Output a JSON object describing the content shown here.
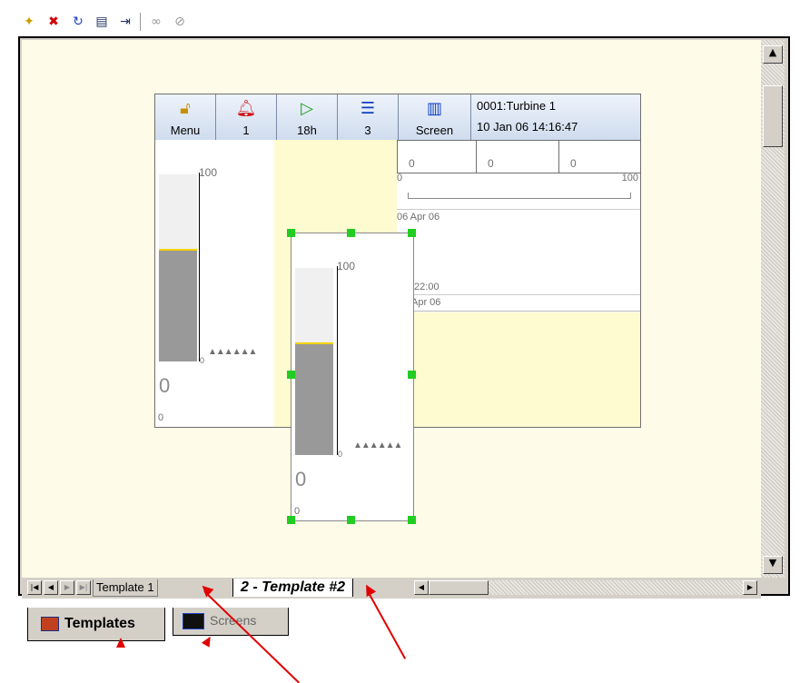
{
  "toolbar": {
    "icons": [
      "new-template-icon",
      "delete-template-icon",
      "refresh-icon",
      "export-icon",
      "import-icon",
      "link-icon",
      "unlink-icon"
    ]
  },
  "device": {
    "buttons": [
      {
        "icon": "lock-icon",
        "label": "Menu"
      },
      {
        "icon": "alarm-bell-icon",
        "label": "1"
      },
      {
        "icon": "play-icon",
        "label": "18h"
      },
      {
        "icon": "list-icon",
        "label": "3"
      },
      {
        "icon": "chart-icon",
        "label": "Screen"
      }
    ],
    "info_line1": "0001:Turbine 1",
    "info_line2": "10 Jan 06  14:16:47",
    "bar_scale_top": "100",
    "bar_scale_bottom": "0",
    "bar_value": "0",
    "bar_small": "0",
    "bar_fill_fraction": 0.6,
    "digital_values": [
      "0",
      "0",
      "0"
    ],
    "chart_scale_min": "0",
    "chart_scale_max": "100",
    "chart_date1": "06 Apr 06",
    "chart_time": ":22:00",
    "chart_date2": "Apr 06"
  },
  "overlay_bar": {
    "scale_top": "100",
    "scale_bottom": "0",
    "value": "0",
    "small": "0",
    "fill_fraction": 0.6
  },
  "sheet_tabs": {
    "tab1": "Template 1",
    "tab2": "2 - Template #2"
  },
  "panel_tabs": {
    "templates": "Templates",
    "screens": "Screens"
  },
  "colors": {
    "canvas": "#fefce9",
    "highlight_zone": "#fffbd0",
    "selection_handle": "#22cc22",
    "annotation_arrow": "#e00000"
  }
}
